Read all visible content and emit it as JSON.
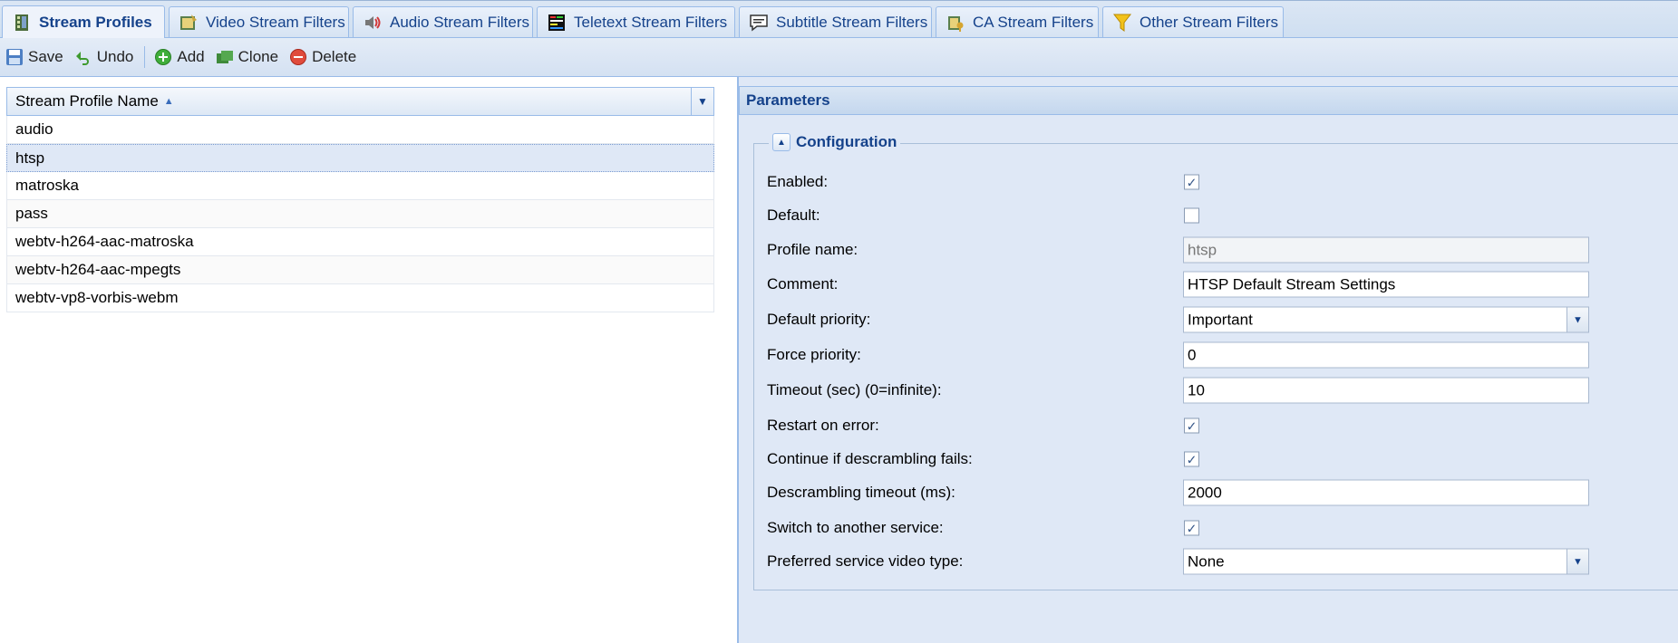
{
  "tabs": [
    {
      "label": "Stream Profiles",
      "icon": "film-strip-icon",
      "active": true
    },
    {
      "label": "Video Stream Filters",
      "icon": "video-film-icon",
      "active": false
    },
    {
      "label": "Audio Stream Filters",
      "icon": "speaker-icon",
      "active": false
    },
    {
      "label": "Teletext Stream Filters",
      "icon": "teletext-icon",
      "active": false
    },
    {
      "label": "Subtitle Stream Filters",
      "icon": "subtitle-icon",
      "active": false
    },
    {
      "label": "CA Stream Filters",
      "icon": "ca-key-icon",
      "active": false
    },
    {
      "label": "Other Stream Filters",
      "icon": "funnel-icon",
      "active": false
    }
  ],
  "toolbar": {
    "save": "Save",
    "undo": "Undo",
    "add": "Add",
    "clone": "Clone",
    "delete": "Delete"
  },
  "grid": {
    "column_header": "Stream Profile Name",
    "rows": [
      {
        "name": "audio",
        "selected": false
      },
      {
        "name": "htsp",
        "selected": true
      },
      {
        "name": "matroska",
        "selected": false
      },
      {
        "name": "pass",
        "selected": false
      },
      {
        "name": "webtv-h264-aac-matroska",
        "selected": false
      },
      {
        "name": "webtv-h264-aac-mpegts",
        "selected": false
      },
      {
        "name": "webtv-vp8-vorbis-webm",
        "selected": false
      }
    ]
  },
  "parameters": {
    "title": "Parameters",
    "section_title": "Configuration",
    "fields": {
      "enabled": {
        "label": "Enabled:",
        "checked": true
      },
      "default": {
        "label": "Default:",
        "checked": false
      },
      "profile_name": {
        "label": "Profile name:",
        "value": "htsp"
      },
      "comment": {
        "label": "Comment:",
        "value": "HTSP Default Stream Settings"
      },
      "default_priority": {
        "label": "Default priority:",
        "value": "Important"
      },
      "force_priority": {
        "label": "Force priority:",
        "value": "0"
      },
      "timeout": {
        "label": "Timeout (sec) (0=infinite):",
        "value": "10"
      },
      "restart_on_error": {
        "label": "Restart on error:",
        "checked": true
      },
      "continue_descrambling": {
        "label": "Continue if descrambling fails:",
        "checked": true
      },
      "descrambling_timeout": {
        "label": "Descrambling timeout (ms):",
        "value": "2000"
      },
      "switch_service": {
        "label": "Switch to another service:",
        "checked": true
      },
      "preferred_video_type": {
        "label": "Preferred service video type:",
        "value": "None"
      }
    }
  },
  "colors": {
    "accent": "#15428b",
    "border": "#99bbe8",
    "panel_bg": "#dfe8f6",
    "selected_row": "#dfe8f6"
  }
}
